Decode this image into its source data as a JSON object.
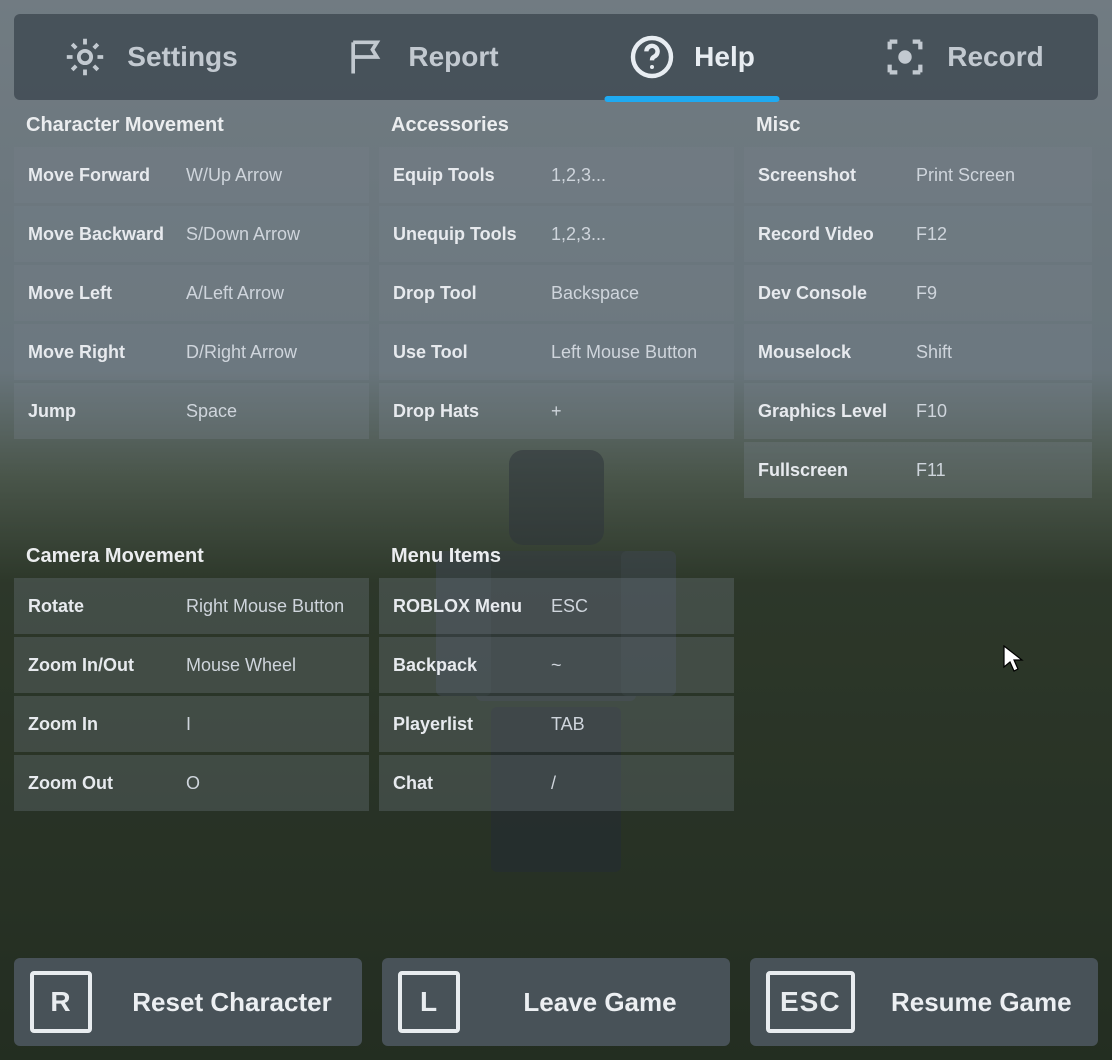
{
  "tabs": {
    "settings": "Settings",
    "report": "Report",
    "help": "Help",
    "record": "Record",
    "active": "help"
  },
  "sections": {
    "character": {
      "title": "Character Movement",
      "rows": [
        {
          "label": "Move Forward",
          "value": "W/Up Arrow"
        },
        {
          "label": "Move Backward",
          "value": "S/Down Arrow"
        },
        {
          "label": "Move Left",
          "value": "A/Left Arrow"
        },
        {
          "label": "Move Right",
          "value": "D/Right Arrow"
        },
        {
          "label": "Jump",
          "value": "Space"
        }
      ]
    },
    "accessories": {
      "title": "Accessories",
      "rows": [
        {
          "label": "Equip Tools",
          "value": "1,2,3..."
        },
        {
          "label": "Unequip Tools",
          "value": "1,2,3..."
        },
        {
          "label": "Drop Tool",
          "value": "Backspace"
        },
        {
          "label": "Use Tool",
          "value": "Left Mouse Button"
        },
        {
          "label": "Drop Hats",
          "value": "+"
        }
      ]
    },
    "misc": {
      "title": "Misc",
      "rows": [
        {
          "label": "Screenshot",
          "value": "Print Screen"
        },
        {
          "label": "Record Video",
          "value": "F12"
        },
        {
          "label": "Dev Console",
          "value": "F9"
        },
        {
          "label": "Mouselock",
          "value": "Shift"
        },
        {
          "label": "Graphics Level",
          "value": "F10"
        },
        {
          "label": "Fullscreen",
          "value": "F11"
        }
      ]
    },
    "camera": {
      "title": "Camera Movement",
      "rows": [
        {
          "label": "Rotate",
          "value": "Right Mouse Button"
        },
        {
          "label": "Zoom In/Out",
          "value": "Mouse Wheel"
        },
        {
          "label": "Zoom In",
          "value": "I"
        },
        {
          "label": "Zoom Out",
          "value": "O"
        }
      ]
    },
    "menuitems": {
      "title": "Menu Items",
      "rows": [
        {
          "label": "ROBLOX Menu",
          "value": "ESC"
        },
        {
          "label": "Backpack",
          "value": "~"
        },
        {
          "label": "Playerlist",
          "value": "TAB"
        },
        {
          "label": "Chat",
          "value": "/"
        }
      ]
    }
  },
  "footer": {
    "reset": {
      "key": "R",
      "label": "Reset Character"
    },
    "leave": {
      "key": "L",
      "label": "Leave Game"
    },
    "resume": {
      "key": "ESC",
      "label": "Resume Game"
    }
  }
}
